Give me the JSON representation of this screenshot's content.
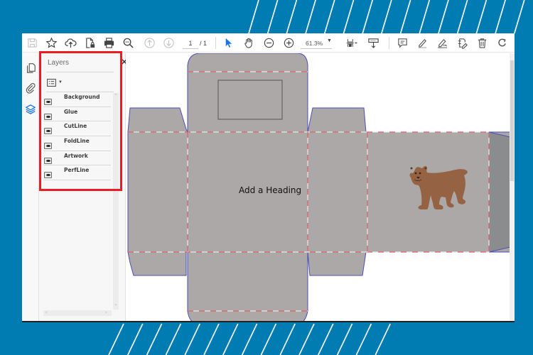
{
  "background": {
    "color": "#017cb3",
    "stripe_color": "#ffffff"
  },
  "toolbar": {
    "buttons": [
      {
        "name": "save",
        "icon": "save-icon",
        "enabled": false
      },
      {
        "name": "bookmark",
        "icon": "star-icon",
        "enabled": true
      },
      {
        "name": "upload",
        "icon": "cloud-upload-icon",
        "enabled": true
      },
      {
        "name": "protect",
        "icon": "file-lock-icon",
        "enabled": true
      },
      {
        "name": "print",
        "icon": "printer-icon",
        "enabled": true
      },
      {
        "name": "find",
        "icon": "magnifier-icon",
        "enabled": true
      },
      {
        "name": "previous-page",
        "icon": "arrow-up-circle-icon",
        "enabled": false
      },
      {
        "name": "next-page",
        "icon": "arrow-down-circle-icon",
        "enabled": false
      }
    ],
    "page_current": "1",
    "page_separator": "/ 1",
    "tools": [
      {
        "name": "select",
        "icon": "cursor-icon",
        "active": true
      },
      {
        "name": "hand",
        "icon": "hand-icon",
        "active": false
      },
      {
        "name": "zoom-out",
        "icon": "minus-circle-icon",
        "active": false
      },
      {
        "name": "zoom-in",
        "icon": "plus-circle-icon",
        "active": false
      }
    ],
    "zoom_value": "61.3%",
    "right_tools": [
      {
        "name": "fit-page",
        "icon": "fit-page-icon"
      },
      {
        "name": "scroll-mode",
        "icon": "scroll-mode-icon"
      },
      {
        "name": "comment",
        "icon": "comment-icon"
      },
      {
        "name": "highlight",
        "icon": "highlighter-icon"
      },
      {
        "name": "sign",
        "icon": "signature-pen-icon"
      },
      {
        "name": "stamp",
        "icon": "stamp-icon"
      },
      {
        "name": "delete",
        "icon": "trash-icon"
      },
      {
        "name": "rotate",
        "icon": "rotate-icon"
      }
    ]
  },
  "left_rail": {
    "items": [
      {
        "name": "page-thumbnails",
        "icon": "pages-icon",
        "active": false
      },
      {
        "name": "attachments",
        "icon": "paperclip-icon",
        "active": false
      },
      {
        "name": "layers",
        "icon": "layers-icon",
        "active": true
      }
    ]
  },
  "layers_panel": {
    "title": "Layers",
    "close_glyph": "✕",
    "layers": [
      {
        "name": "Background",
        "visible": true
      },
      {
        "name": "Glue",
        "visible": true
      },
      {
        "name": "CutLine",
        "visible": true
      },
      {
        "name": "FoldLine",
        "visible": true
      },
      {
        "name": "Artwork",
        "visible": true
      },
      {
        "name": "PerfLine",
        "visible": true
      }
    ],
    "highlight_color": "#ec1c24"
  },
  "document": {
    "heading_text": "Add a Heading",
    "panel_fill": "#aca8a7",
    "side_flap_fill": "#8b8c8e",
    "cut_line_color": "#4b4fb8",
    "fold_dash_red": "#e0636a",
    "fold_dash_white": "#e8e8e8",
    "artwork": "bear-illustration",
    "bear_color": "#956343"
  }
}
